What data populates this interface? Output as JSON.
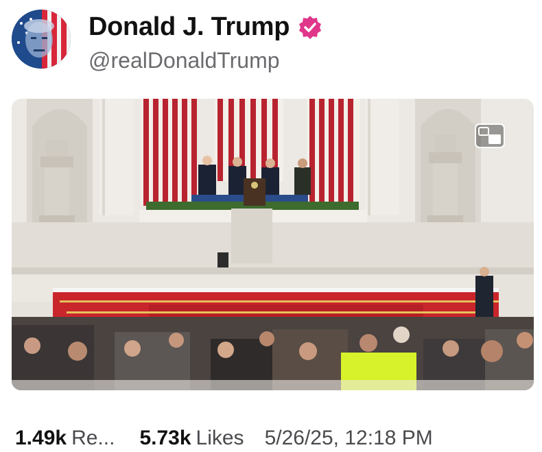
{
  "post": {
    "author": {
      "display_name": "Donald J. Trump",
      "handle": "@realDonaldTrump",
      "verified": true,
      "verified_color": "#e0378a",
      "avatar_icon": "flag-portrait-avatar"
    },
    "media": {
      "type": "video",
      "control_icon": "picture-in-picture-icon"
    },
    "stats": {
      "reposts_count": "1.49k",
      "reposts_label": "Re...",
      "likes_count": "5.73k",
      "likes_label": "Likes",
      "timestamp": "5/26/25, 12:18 PM"
    }
  }
}
